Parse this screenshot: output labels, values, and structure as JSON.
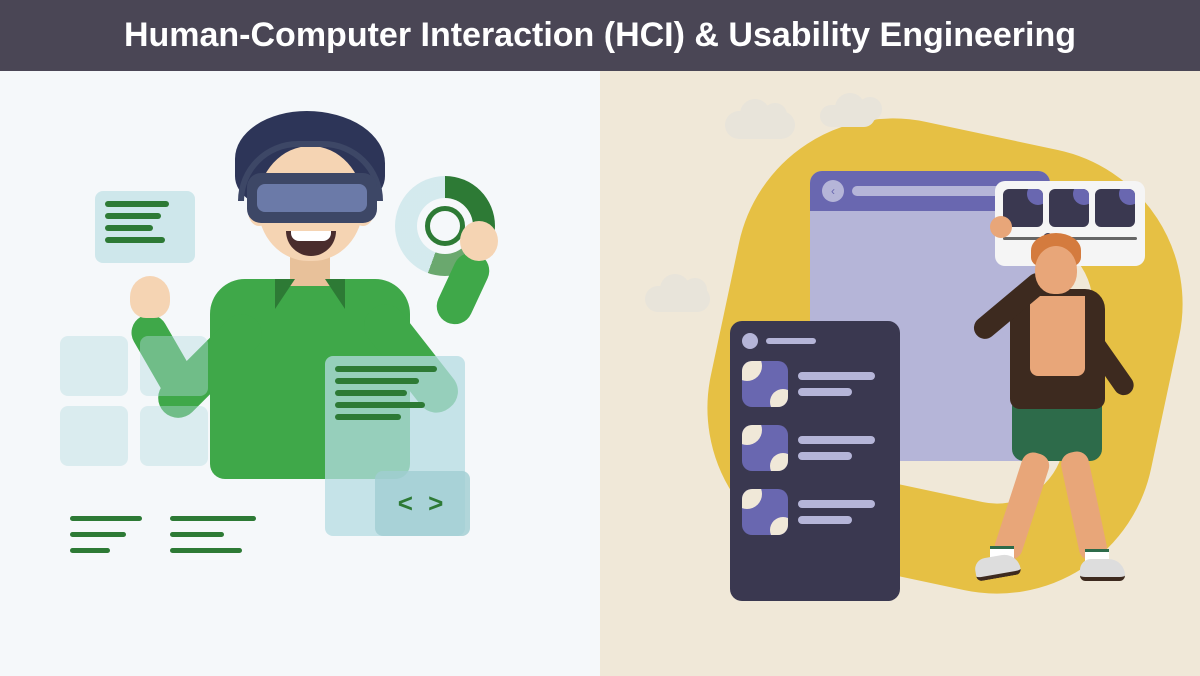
{
  "header": {
    "title": "Human-Computer Interaction (HCI) & Usability Engineering"
  },
  "illustrations": {
    "code_symbol": "< >"
  },
  "colors": {
    "header_bg": "#4a4655",
    "accent_green": "#3fa849",
    "accent_yellow": "#e6c044",
    "accent_purple": "#6967b0",
    "panel_dark": "#3a3850"
  }
}
